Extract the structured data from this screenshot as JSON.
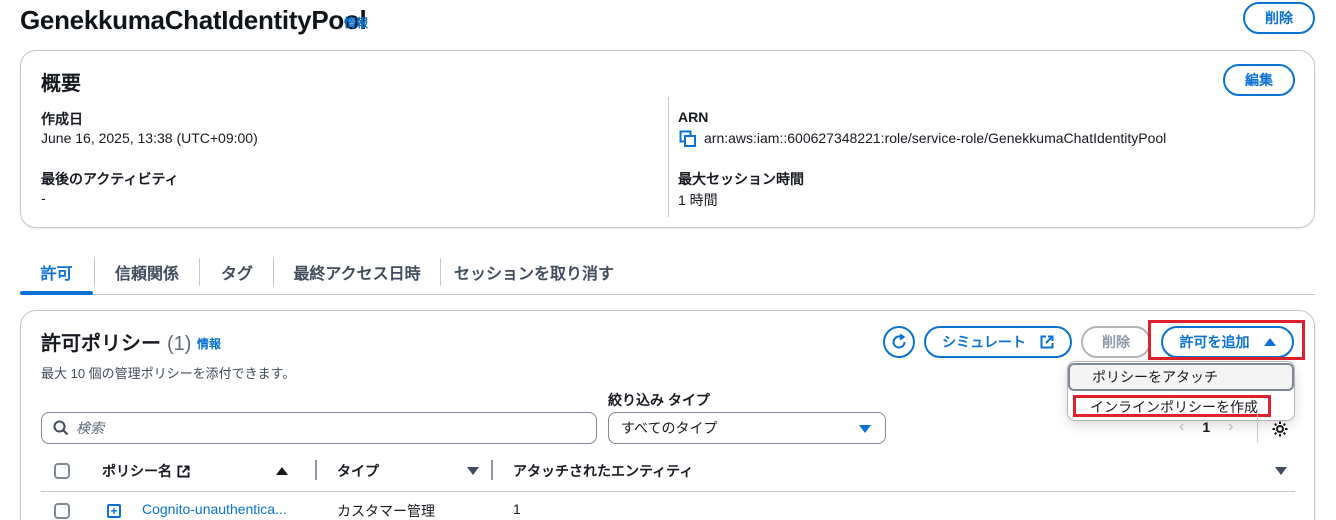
{
  "page": {
    "title": "GenekkumaChatIdentityPool",
    "info": "情報",
    "delete_label": "削除"
  },
  "summary": {
    "title": "概要",
    "edit_label": "編集",
    "created_label": "作成日",
    "created_value": "June 16, 2025, 13:38 (UTC+09:00)",
    "last_activity_label": "最後のアクティビティ",
    "last_activity_value": "-",
    "arn_label": "ARN",
    "arn_value": "arn:aws:iam::600627348221:role/service-role/GenekkumaChatIdentityPool",
    "max_session_label": "最大セッション時間",
    "max_session_value": "1 時間"
  },
  "tabs": [
    {
      "label": "許可",
      "active": true
    },
    {
      "label": "信頼関係"
    },
    {
      "label": "タグ"
    },
    {
      "label": "最終アクセス日時"
    },
    {
      "label": "セッションを取り消す"
    }
  ],
  "permissions": {
    "title": "許可ポリシー",
    "count": "(1)",
    "info": "情報",
    "description": "最大 10 個の管理ポリシーを添付できます。",
    "simulate_label": "シミュレート",
    "delete_label": "削除",
    "add_label": "許可を追加",
    "menu": [
      {
        "label": "ポリシーをアタッチ"
      },
      {
        "label": "インラインポリシーを作成"
      }
    ],
    "filter_label": "絞り込み タイプ",
    "search_placeholder": "検索",
    "filter_value": "すべてのタイプ",
    "page_number": "1",
    "columns": [
      "ポリシー名",
      "タイプ",
      "アタッチされたエンティティ"
    ],
    "rows": [
      {
        "name": "Cognito-unauthentica...",
        "type": "カスタマー管理",
        "entities": "1"
      }
    ]
  },
  "colors": {
    "accent": "#0972d3",
    "highlight": "#e0202a"
  }
}
